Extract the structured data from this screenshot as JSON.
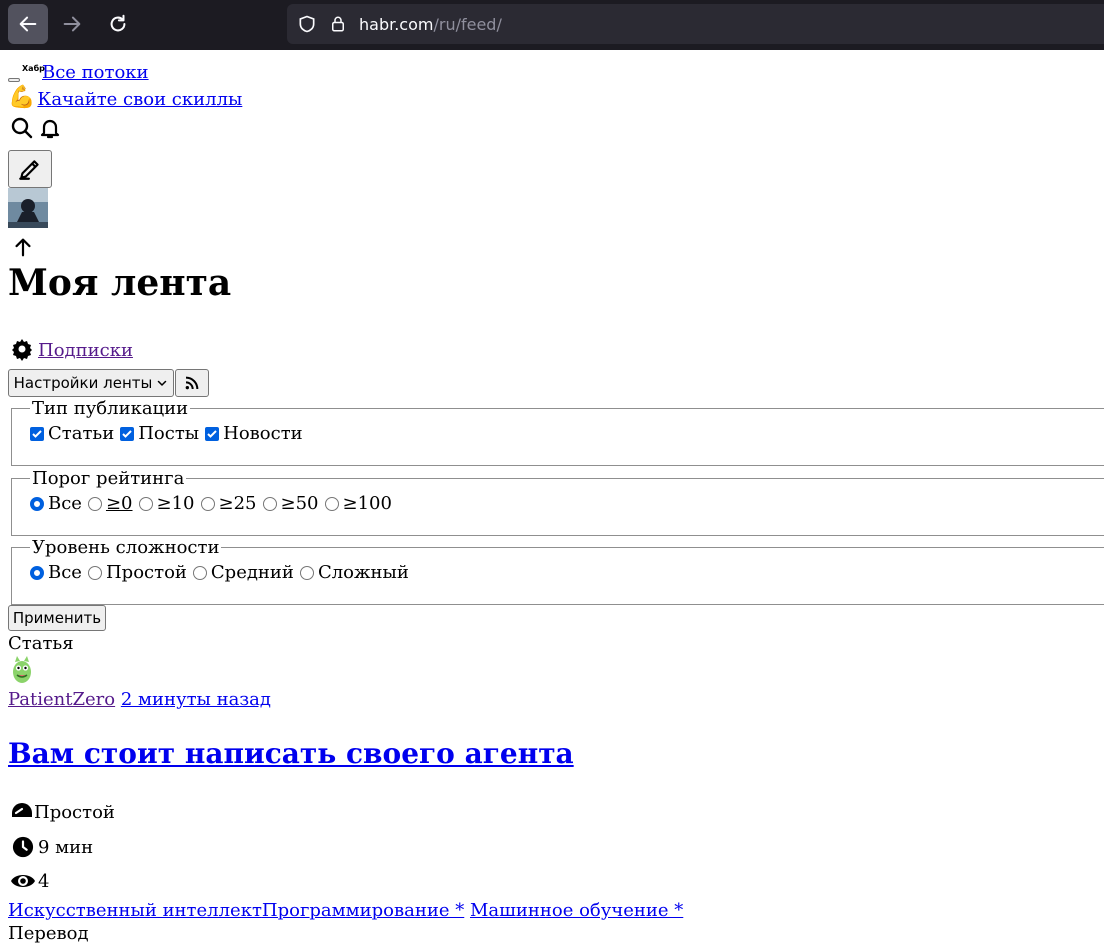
{
  "browser": {
    "url_host": "habr.com",
    "url_path": "/ru/feed/"
  },
  "header": {
    "logo_text": "Хабр",
    "flows_link": "Все потоки",
    "skills_link": "Качайте свои скиллы"
  },
  "page": {
    "title": "Моя лента",
    "subscriptions_link": "Подписки",
    "feed_settings_button": "Настройки ленты",
    "apply_button": "Применить"
  },
  "filters": {
    "publication_type": {
      "legend": "Тип публикации",
      "options": [
        "Статьи",
        "Посты",
        "Новости"
      ],
      "checked": [
        true,
        true,
        true
      ]
    },
    "rating_threshold": {
      "legend": "Порог рейтинга",
      "options": [
        "Все",
        "≥0",
        "≥10",
        "≥25",
        "≥50",
        "≥100"
      ],
      "selected": "Все"
    },
    "difficulty": {
      "legend": "Уровень сложности",
      "options": [
        "Все",
        "Простой",
        "Средний",
        "Сложный"
      ],
      "selected": "Все"
    }
  },
  "post": {
    "type_label": "Статья",
    "author": "PatientZero",
    "time": "2 минуты назад",
    "title": "Вам стоит написать своего агента",
    "difficulty": "Простой",
    "reading_time": "9 мин",
    "views": "4",
    "hubs": [
      "Искусственный интеллект",
      "Программирование *",
      "Машинное обучение *"
    ],
    "translation_label": "Перевод"
  }
}
